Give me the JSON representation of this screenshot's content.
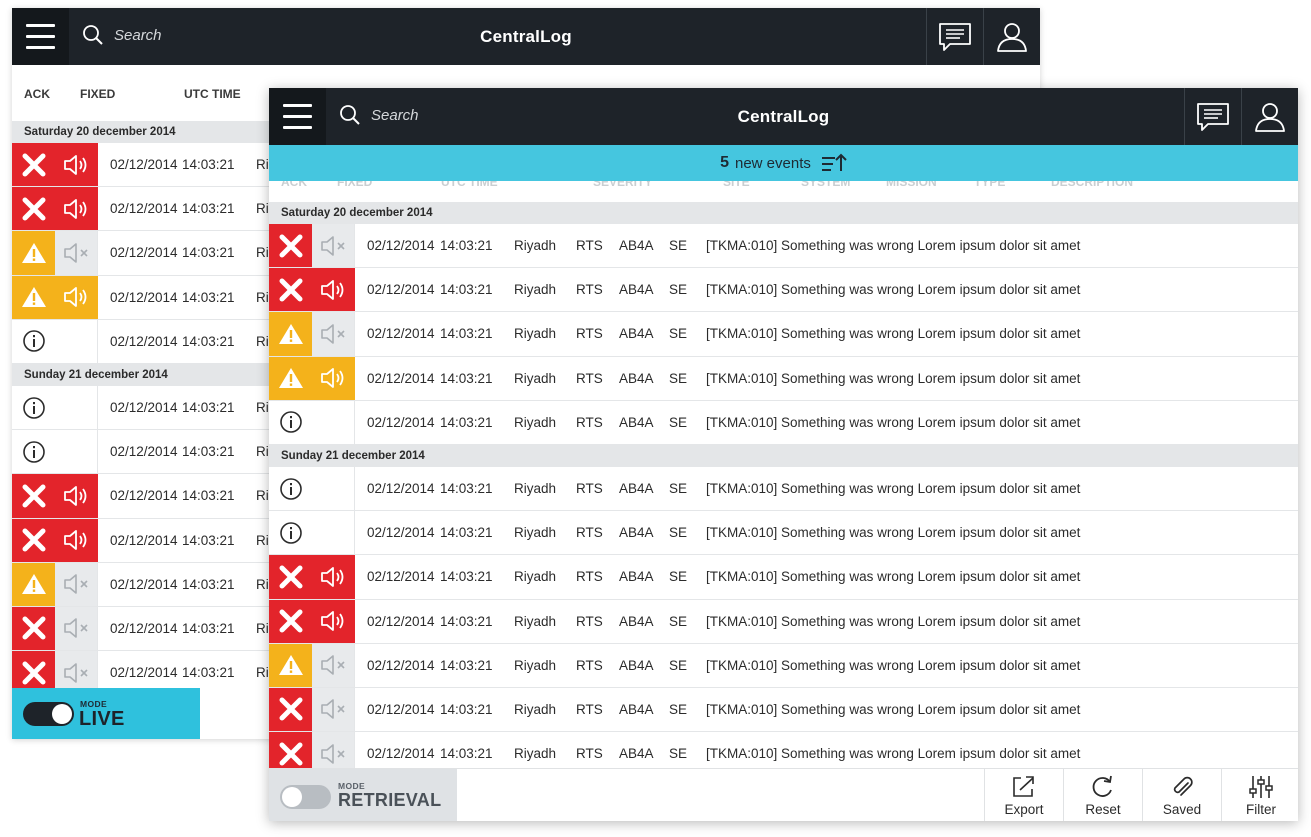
{
  "back_window": {
    "app_title": "CentralLog",
    "search_placeholder": "Search",
    "columns": {
      "ack": "ACK",
      "fixed": "FIXED",
      "utc_time": "UTC TIME"
    },
    "groups": [
      {
        "day": "Saturday 20 december 2014",
        "rows": [
          {
            "severity": "error",
            "sound": true,
            "date": "02/12/2014",
            "time": "14:03:21",
            "site": "Ri"
          },
          {
            "severity": "error",
            "sound": true,
            "date": "02/12/2014",
            "time": "14:03:21",
            "site": "Ri"
          },
          {
            "severity": "warning",
            "sound": false,
            "date": "02/12/2014",
            "time": "14:03:21",
            "site": "Ri"
          },
          {
            "severity": "warning",
            "sound": true,
            "date": "02/12/2014",
            "time": "14:03:21",
            "site": "Ri"
          },
          {
            "severity": "info",
            "sound": false,
            "date": "02/12/2014",
            "time": "14:03:21",
            "site": "Ri"
          }
        ]
      },
      {
        "day": "Sunday 21 december 2014",
        "rows": [
          {
            "severity": "info",
            "sound": false,
            "date": "02/12/2014",
            "time": "14:03:21",
            "site": "Ri"
          },
          {
            "severity": "info",
            "sound": false,
            "date": "02/12/2014",
            "time": "14:03:21",
            "site": "Ri"
          },
          {
            "severity": "error",
            "sound": true,
            "date": "02/12/2014",
            "time": "14:03:21",
            "site": "Ri"
          },
          {
            "severity": "error",
            "sound": true,
            "date": "02/12/2014",
            "time": "14:03:21",
            "site": "Ri"
          },
          {
            "severity": "warning",
            "sound": false,
            "date": "02/12/2014",
            "time": "14:03:21",
            "site": "Ri"
          },
          {
            "severity": "error",
            "sound": false,
            "date": "02/12/2014",
            "time": "14:03:21",
            "site": "Ri"
          },
          {
            "severity": "error",
            "sound": false,
            "date": "02/12/2014",
            "time": "14:03:21",
            "site": "Ri"
          }
        ]
      }
    ],
    "mode": {
      "label": "MODE",
      "value": "LIVE",
      "toggle_on": true
    }
  },
  "front_window": {
    "app_title": "CentralLog",
    "search_placeholder": "Search",
    "banner": {
      "count": "5",
      "text": "new events"
    },
    "columns": [
      "ACK",
      "FIXED",
      "UTC TIME",
      "SEVERITY",
      "SITE",
      "SYSTEM",
      "MISSION",
      "TYPE",
      "DESCRIPTION"
    ],
    "groups": [
      {
        "day": "Saturday 20 december 2014",
        "rows": [
          {
            "severity": "error",
            "sound": false,
            "date": "02/12/2014",
            "time": "14:03:21",
            "site": "Riyadh",
            "system": "RTS",
            "mission": "AB4A",
            "type": "SE",
            "description": "[TKMA:010] Something was wrong Lorem ipsum dolor sit amet"
          },
          {
            "severity": "error",
            "sound": true,
            "date": "02/12/2014",
            "time": "14:03:21",
            "site": "Riyadh",
            "system": "RTS",
            "mission": "AB4A",
            "type": "SE",
            "description": "[TKMA:010] Something was wrong Lorem ipsum dolor sit amet"
          },
          {
            "severity": "warning",
            "sound": false,
            "date": "02/12/2014",
            "time": "14:03:21",
            "site": "Riyadh",
            "system": "RTS",
            "mission": "AB4A",
            "type": "SE",
            "description": "[TKMA:010] Something was wrong Lorem ipsum dolor sit amet"
          },
          {
            "severity": "warning",
            "sound": true,
            "date": "02/12/2014",
            "time": "14:03:21",
            "site": "Riyadh",
            "system": "RTS",
            "mission": "AB4A",
            "type": "SE",
            "description": "[TKMA:010] Something was wrong Lorem ipsum dolor sit amet"
          },
          {
            "severity": "info",
            "sound": false,
            "date": "02/12/2014",
            "time": "14:03:21",
            "site": "Riyadh",
            "system": "RTS",
            "mission": "AB4A",
            "type": "SE",
            "description": "[TKMA:010] Something was wrong Lorem ipsum dolor sit amet"
          }
        ]
      },
      {
        "day": "Sunday 21 december 2014",
        "rows": [
          {
            "severity": "info",
            "sound": false,
            "date": "02/12/2014",
            "time": "14:03:21",
            "site": "Riyadh",
            "system": "RTS",
            "mission": "AB4A",
            "type": "SE",
            "description": "[TKMA:010] Something was wrong Lorem ipsum dolor sit amet"
          },
          {
            "severity": "info",
            "sound": false,
            "date": "02/12/2014",
            "time": "14:03:21",
            "site": "Riyadh",
            "system": "RTS",
            "mission": "AB4A",
            "type": "SE",
            "description": "[TKMA:010] Something was wrong Lorem ipsum dolor sit amet"
          },
          {
            "severity": "error",
            "sound": true,
            "date": "02/12/2014",
            "time": "14:03:21",
            "site": "Riyadh",
            "system": "RTS",
            "mission": "AB4A",
            "type": "SE",
            "description": "[TKMA:010] Something was wrong Lorem ipsum dolor sit amet"
          },
          {
            "severity": "error",
            "sound": true,
            "date": "02/12/2014",
            "time": "14:03:21",
            "site": "Riyadh",
            "system": "RTS",
            "mission": "AB4A",
            "type": "SE",
            "description": "[TKMA:010] Something was wrong Lorem ipsum dolor sit amet"
          },
          {
            "severity": "warning",
            "sound": false,
            "date": "02/12/2014",
            "time": "14:03:21",
            "site": "Riyadh",
            "system": "RTS",
            "mission": "AB4A",
            "type": "SE",
            "description": "[TKMA:010] Something was wrong Lorem ipsum dolor sit amet"
          },
          {
            "severity": "error",
            "sound": false,
            "date": "02/12/2014",
            "time": "14:03:21",
            "site": "Riyadh",
            "system": "RTS",
            "mission": "AB4A",
            "type": "SE",
            "description": "[TKMA:010] Something was wrong Lorem ipsum dolor sit amet"
          },
          {
            "severity": "error",
            "sound": false,
            "date": "02/12/2014",
            "time": "14:03:21",
            "site": "Riyadh",
            "system": "RTS",
            "mission": "AB4A",
            "type": "SE",
            "description": "[TKMA:010] Something was wrong Lorem ipsum dolor sit amet"
          }
        ]
      }
    ],
    "mode": {
      "label": "MODE",
      "value": "RETRIEVAL",
      "toggle_on": false
    },
    "actions": [
      {
        "label": "Export",
        "icon": "export-icon"
      },
      {
        "label": "Reset",
        "icon": "reset-icon"
      },
      {
        "label": "Saved",
        "icon": "paperclip-icon"
      },
      {
        "label": "Filter",
        "icon": "filter-sliders-icon"
      }
    ]
  },
  "colors": {
    "topbar": "#1e2329",
    "error": "#e3242b",
    "warning": "#f4b21b",
    "accent_cyan": "#2fc1dd",
    "banner": "#45c6df",
    "day_separator": "#e4e6e8"
  }
}
